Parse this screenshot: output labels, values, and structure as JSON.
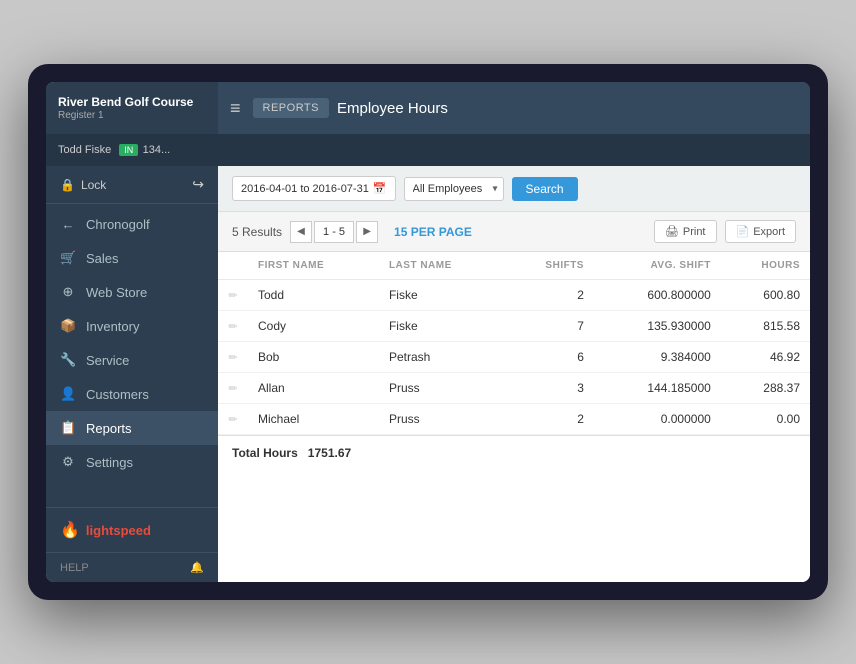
{
  "device": {
    "company": "River Bend Golf Course",
    "register": "Register 1",
    "user": "Todd Fiske",
    "badge": "IN",
    "badge_num": "134..."
  },
  "header": {
    "breadcrumb": "REPORTS",
    "title": "Employee Hours",
    "hamburger": "≡"
  },
  "sidebar": {
    "lock_label": "Lock",
    "items": [
      {
        "id": "chronogolf",
        "label": "Chronogolf",
        "icon": "←"
      },
      {
        "id": "sales",
        "label": "Sales",
        "icon": "🛒"
      },
      {
        "id": "webstore",
        "label": "Web Store",
        "icon": "⊕"
      },
      {
        "id": "inventory",
        "label": "Inventory",
        "icon": "📦"
      },
      {
        "id": "service",
        "label": "Service",
        "icon": "🔧"
      },
      {
        "id": "customers",
        "label": "Customers",
        "icon": "👤"
      },
      {
        "id": "reports",
        "label": "Reports",
        "icon": "📋"
      },
      {
        "id": "settings",
        "label": "Settings",
        "icon": "⚙"
      }
    ],
    "logo": "lightspeed",
    "help": "HELP"
  },
  "filters": {
    "date_range": "2016-04-01 to 2016-07-31",
    "employee_option": "All Employees",
    "search_label": "Search"
  },
  "results": {
    "count": "5 Results",
    "page_range": "1 - 5",
    "per_page": "15 PER PAGE",
    "print_label": "Print",
    "export_label": "Export"
  },
  "table": {
    "columns": [
      {
        "id": "edit",
        "label": "",
        "align": "left"
      },
      {
        "id": "first_name",
        "label": "FIRST NAME",
        "align": "left"
      },
      {
        "id": "last_name",
        "label": "LAST NAME",
        "align": "left"
      },
      {
        "id": "shifts",
        "label": "SHIFTS",
        "align": "right"
      },
      {
        "id": "avg_shift",
        "label": "AVG. SHIFT",
        "align": "right"
      },
      {
        "id": "hours",
        "label": "HOURS",
        "align": "right"
      }
    ],
    "rows": [
      {
        "first_name": "Todd",
        "last_name": "Fiske",
        "shifts": "2",
        "avg_shift": "600.800000",
        "hours": "600.80"
      },
      {
        "first_name": "Cody",
        "last_name": "Fiske",
        "shifts": "7",
        "avg_shift": "135.930000",
        "hours": "815.58"
      },
      {
        "first_name": "Bob",
        "last_name": "Petrash",
        "shifts": "6",
        "avg_shift": "9.384000",
        "hours": "46.92"
      },
      {
        "first_name": "Allan",
        "last_name": "Pruss",
        "shifts": "3",
        "avg_shift": "144.185000",
        "hours": "288.37"
      },
      {
        "first_name": "Michael",
        "last_name": "Pruss",
        "shifts": "2",
        "avg_shift": "0.000000",
        "hours": "0.00"
      }
    ],
    "total_label": "Total Hours",
    "total_value": "1751.67"
  }
}
